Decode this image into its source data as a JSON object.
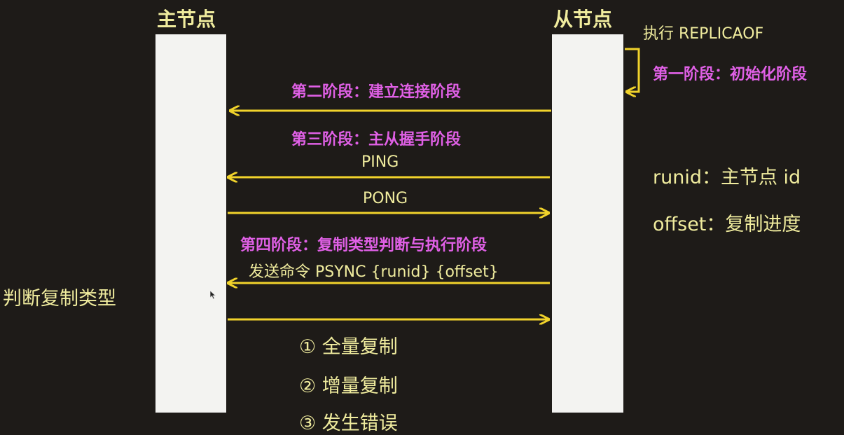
{
  "master": {
    "title": "主节点"
  },
  "slave": {
    "title": "从节点",
    "exec_cmd": "执行 REPLICAOF"
  },
  "phases": {
    "phase1": "第一阶段：初始化阶段",
    "phase2": "第二阶段：建立连接阶段",
    "phase3": "第三阶段：主从握手阶段",
    "phase4": "第四阶段：复制类型判断与执行阶段"
  },
  "messages": {
    "ping": "PING",
    "pong": "PONG",
    "psync": "发送命令 PSYNC {runid} {offset}"
  },
  "info": {
    "runid": "runid：主节点 id",
    "offset": "offset：复制进度"
  },
  "judge_label": "判断复制类型",
  "options": [
    "① 全量复制",
    "② 增量复制",
    "③ 发生错误"
  ],
  "colors": {
    "background": "#1e1b18",
    "accent_yellow": "#f0ec9e",
    "arrow_yellow": "#f1d32b",
    "phase_magenta": "#e060e6",
    "node_bar": "#f3f3f1"
  }
}
